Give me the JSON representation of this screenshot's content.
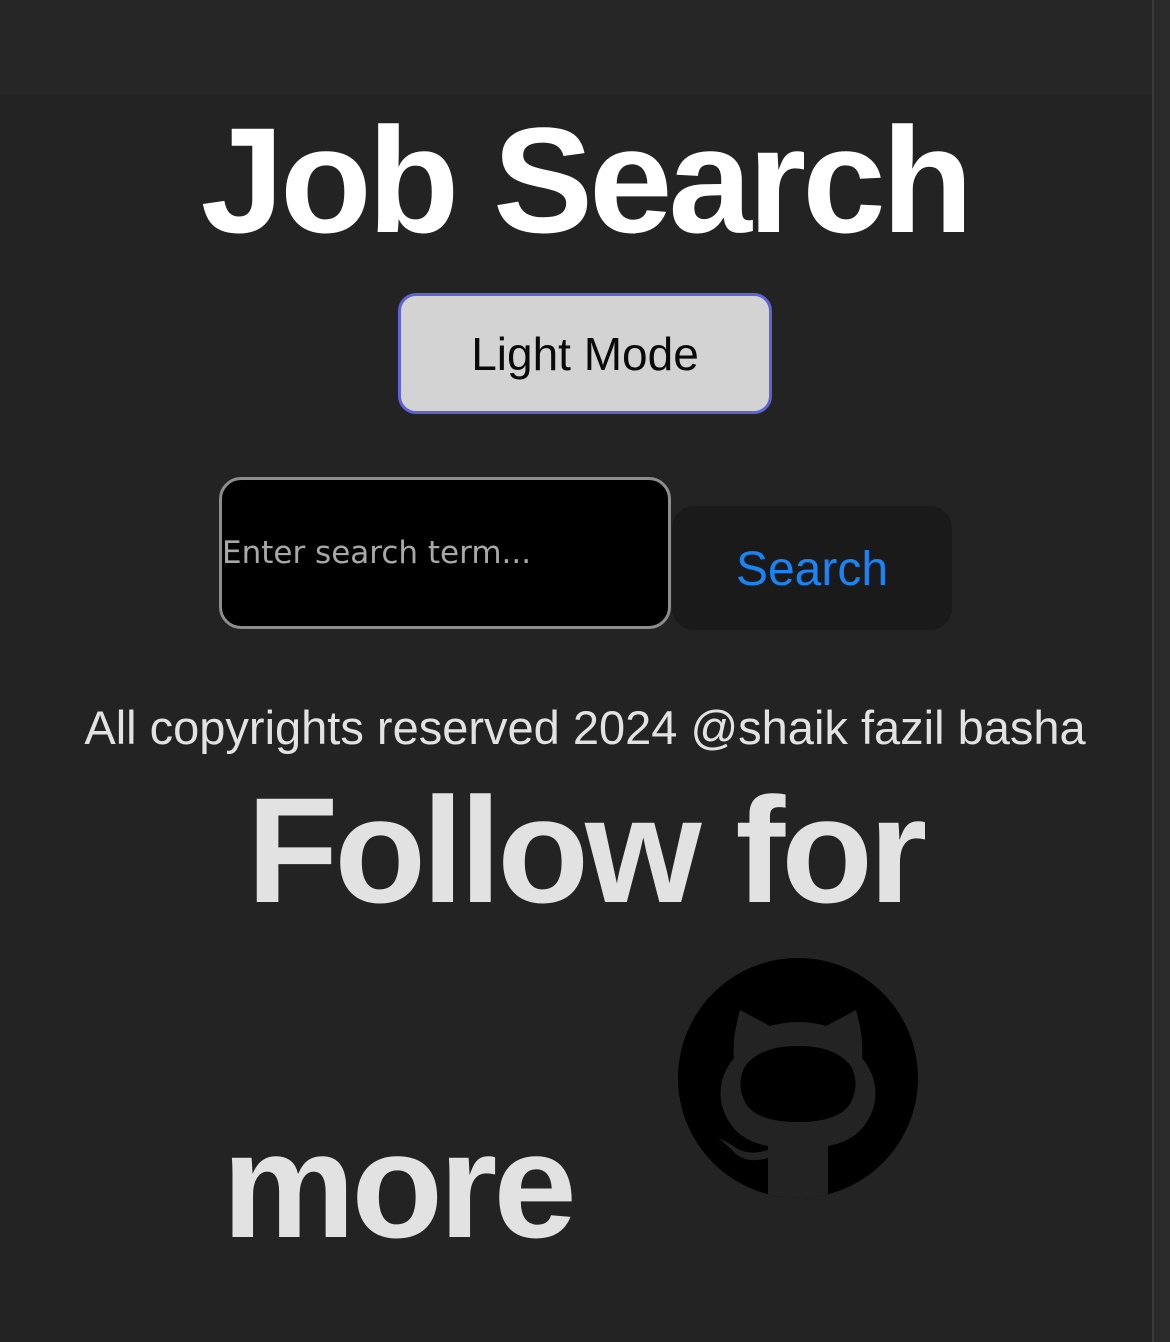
{
  "header": {
    "title": "Job Search",
    "mode_toggle_label": "Light Mode"
  },
  "search": {
    "placeholder": "Enter search term...",
    "value": "",
    "button_label": "Search"
  },
  "footer": {
    "copyright": "All copyrights reserved 2024 @shaik fazil basha",
    "follow_line1": "Follow for",
    "follow_line2": "more",
    "github_icon": "github-icon"
  },
  "colors": {
    "background": "#232323",
    "title_text": "#ffffff",
    "mode_button_bg": "#d3d3d3",
    "mode_button_border": "#6063d6",
    "search_button_text": "#1a84f5",
    "input_bg": "#000000"
  }
}
